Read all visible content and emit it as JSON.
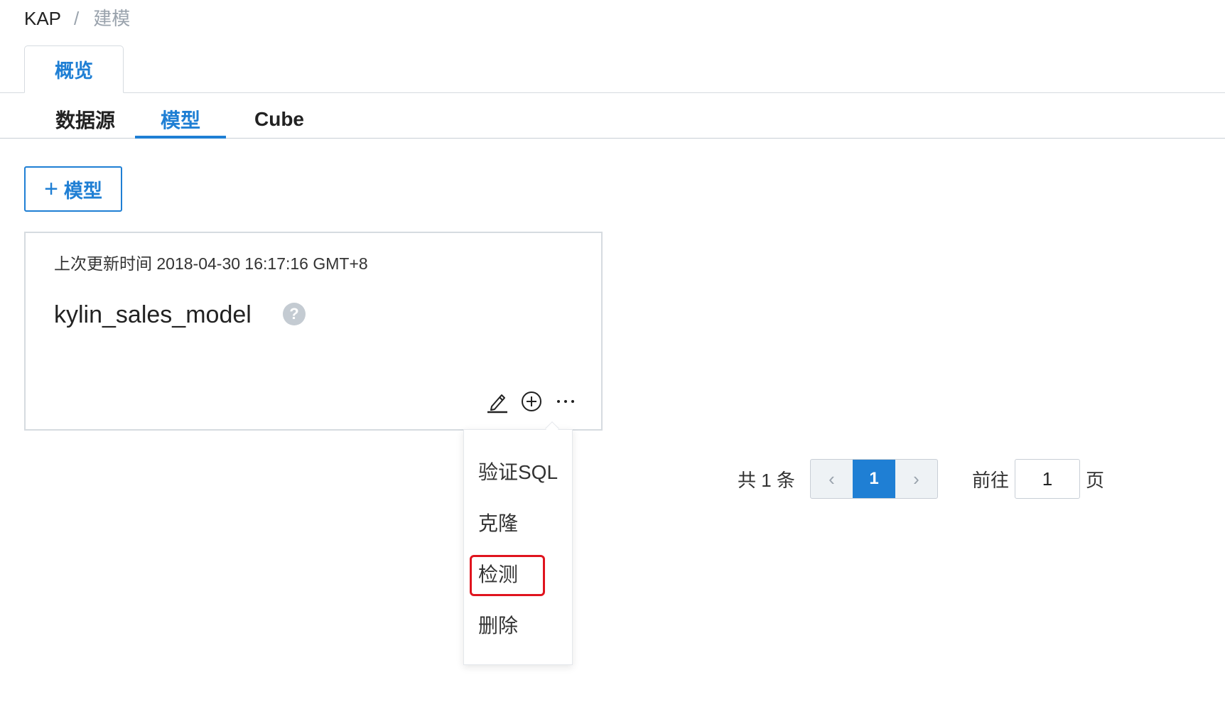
{
  "breadcrumb": {
    "root": "KAP",
    "separator": "/",
    "current": "建模"
  },
  "top_tab": {
    "label": "概览"
  },
  "sub_tabs": [
    {
      "label": "数据源"
    },
    {
      "label": "模型"
    },
    {
      "label": "Cube"
    }
  ],
  "add_button": {
    "icon": "+",
    "label": "模型"
  },
  "model_card": {
    "updated": "上次更新时间 2018-04-30 16:17:16 GMT+8",
    "name": "kylin_sales_model",
    "help_icon": "?",
    "actions": [
      "edit-icon",
      "add-circle-icon",
      "more-icon"
    ]
  },
  "dropdown": {
    "items": [
      {
        "label": "验证SQL"
      },
      {
        "label": "克隆"
      },
      {
        "label": "检测"
      },
      {
        "label": "删除"
      }
    ],
    "highlighted_index": 2
  },
  "pagination": {
    "total_text": "共 1 条",
    "prev": "‹",
    "current": "1",
    "next": "›",
    "goto_label": "前往",
    "goto_value": "1",
    "page_unit": "页"
  },
  "colors": {
    "accent": "#1f7fd4",
    "highlight": "#e0141e"
  }
}
